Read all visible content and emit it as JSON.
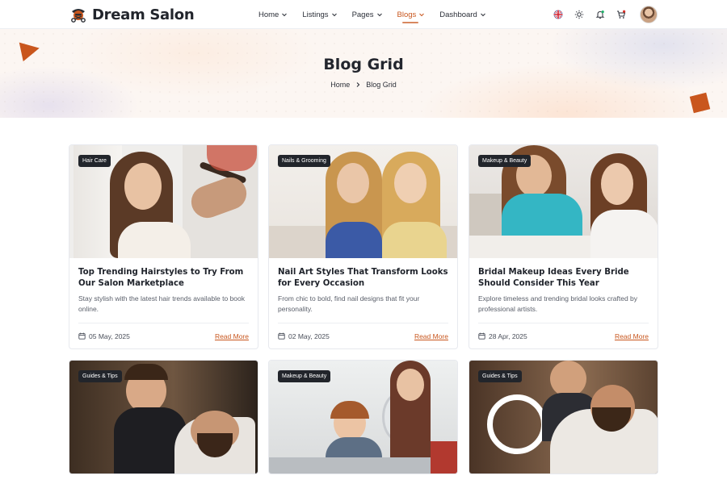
{
  "brand": {
    "name": "Dream Salon",
    "accent": "#c8561d"
  },
  "nav": [
    {
      "label": "Home"
    },
    {
      "label": "Listings"
    },
    {
      "label": "Pages"
    },
    {
      "label": "Blogs",
      "active": true
    },
    {
      "label": "Dashboard"
    }
  ],
  "header_icons": [
    "uk-flag-icon",
    "sun-icon",
    "bell-icon",
    "cart-icon",
    "avatar"
  ],
  "hero": {
    "title": "Blog Grid",
    "breadcrumb": [
      "Home",
      "Blog Grid"
    ]
  },
  "posts": [
    {
      "tag": "Hair Care",
      "title": "Top Trending Hairstyles to Try From Our Salon Marketplace",
      "excerpt": "Stay stylish with the latest hair trends available to book online.",
      "date": "05 May, 2025",
      "cta": "Read More"
    },
    {
      "tag": "Nails & Grooming",
      "title": "Nail Art Styles That Transform Looks for Every Occasion",
      "excerpt": "From chic to bold, find nail designs that fit your personality.",
      "date": "02 May, 2025",
      "cta": "Read More"
    },
    {
      "tag": "Makeup & Beauty",
      "title": "Bridal Makeup Ideas Every Bride Should Consider This Year",
      "excerpt": "Explore timeless and trending bridal looks crafted by professional artists.",
      "date": "28 Apr, 2025",
      "cta": "Read More"
    },
    {
      "tag": "Guides & Tips"
    },
    {
      "tag": "Makeup & Beauty"
    },
    {
      "tag": "Guides & Tips"
    }
  ]
}
